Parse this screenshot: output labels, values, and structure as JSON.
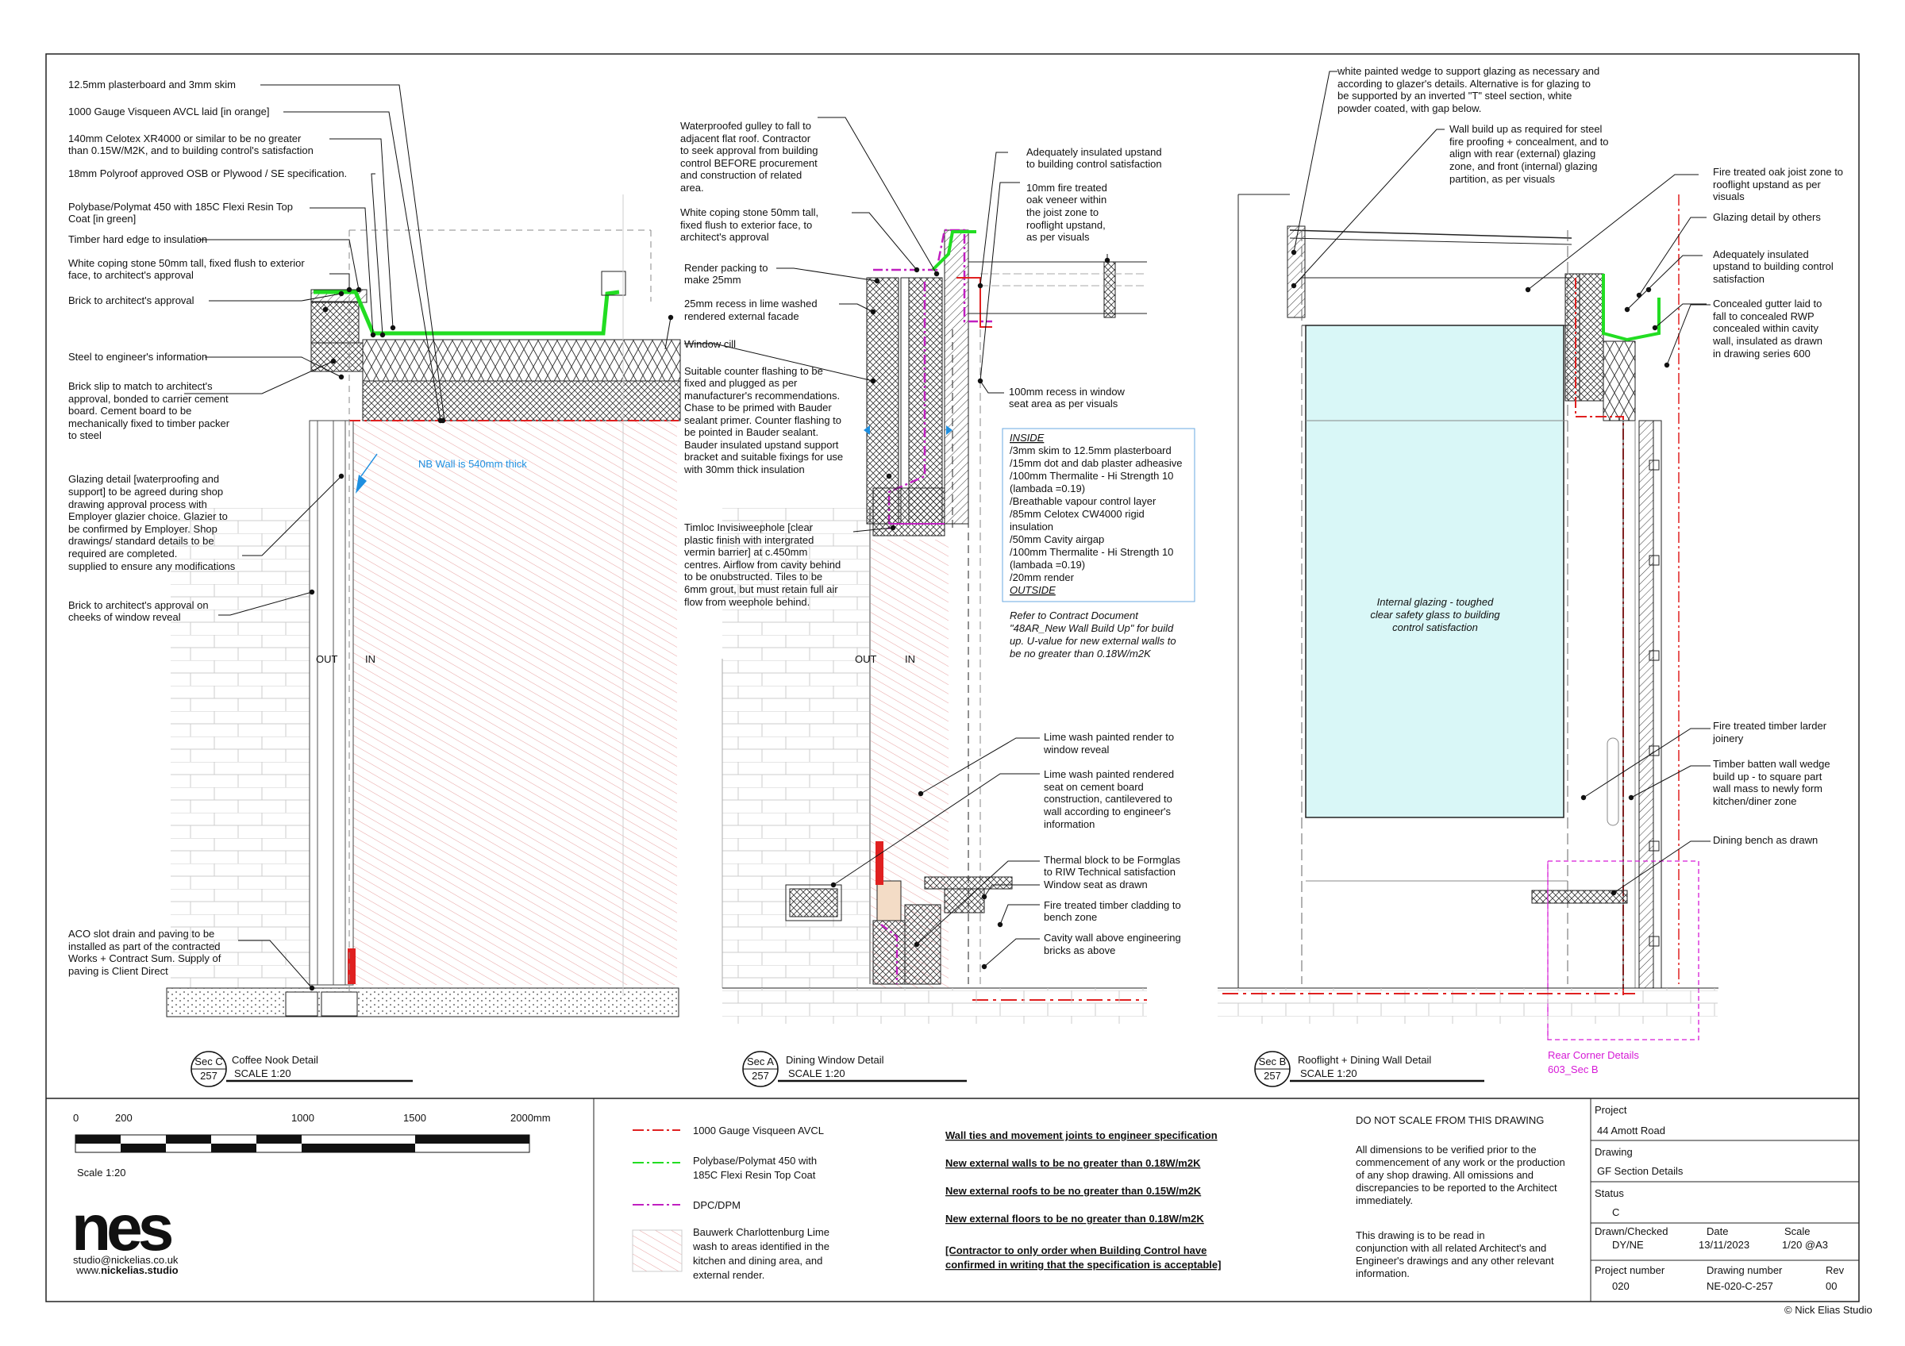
{
  "colors": {
    "avcl": "#e02020",
    "polybase": "#22dd22",
    "dpc": "#c020c0",
    "limewash": "#e7a0a0",
    "glazing": "#d9f7f7",
    "blue_note": "#1e8fe0",
    "magenta_note": "#d61ad6"
  },
  "detail1": {
    "labels": [
      "12.5mm plasterboard and 3mm skim",
      "1000 Gauge Visqueen AVCL laid [in orange]",
      "140mm Celotex XR4000 or similar to be no greater",
      "than 0.15W/M2K, and to building control's satisfaction",
      "18mm Polyroof  approved OSB or Plywood / SE specification.",
      "Polybase/Polymat 450 with 185C Flexi Resin Top",
      "Coat [in green]",
      "Timber hard edge to insulation",
      "White coping stone 50mm tall, fixed flush to exterior",
      "face, to architect's approval",
      "Brick to architect's approval",
      "Steel to engineer's information",
      "Brick slip to match to architect's",
      "approval, bonded to carrier cement",
      "board. Cement board to be",
      "mechanically fixed to timber packer",
      "to steel",
      "Glazing detail [waterproofing and",
      "support] to be agreed during shop",
      "drawing approval process with",
      "Employer glazier choice. Glazier to",
      "be confirmed by Employer. Shop",
      "drawings/ standard details to be",
      "supplied to ensure any modifications",
      "required are completed.",
      "Brick to architect's approval on",
      "cheeks of window reveal",
      "ACO slot drain and paving to be",
      "installed as part of the contracted",
      "Works + Contract Sum. Supply of",
      "paving is Client Direct"
    ],
    "wall_note": "NB Wall is 540mm thick",
    "out": "OUT",
    "in": "IN",
    "title": "Coffee Nook Detail",
    "scale": "SCALE 1:20",
    "ref_top": "Sec C",
    "ref_bottom": "257"
  },
  "detail2": {
    "labels": [
      "Waterproofed gulley to fall to",
      "adjacent flat roof. Contractor",
      "to seek approval from building",
      "control BEFORE procurement",
      "and construction of related",
      "area.",
      "White coping stone 50mm tall,",
      "fixed flush to exterior face, to",
      "architect's approval",
      "Render packing to",
      "make 25mm",
      "25mm recess in lime washed",
      "rendered external facade",
      "Window cill",
      "Suitable counter flashing to be",
      "fixed and plugged as per",
      "manufacturer's recommendations.",
      "Chase to be primed with Bauder",
      "sealant primer. Counter flashing to",
      "be pointed in Bauder sealant.",
      "Bauder insulated upstand support",
      "bracket and suitable fixings for use",
      "with 30mm thick insulation",
      "Timloc Invisiweephole [clear",
      "plastic finish with intergrated",
      "vermin barrier] at c.450mm",
      "centres. Airflow from cavity behind",
      "to be onubstructed. Tiles to be",
      "6mm grout, but must retain full air",
      "flow from weephole behind.",
      "Adequately insulated upstand",
      "to building control satisfaction",
      "10mm fire treated",
      "oak veneer within",
      "the joist zone to",
      "rooflight upstand,",
      "as per visuals",
      "100mm recess in window",
      "seat area as per visuals",
      "Lime wash painted render to",
      "window reveal",
      "Lime wash painted rendered",
      "seat on cement board",
      "construction, cantilevered to",
      "wall according to engineer's",
      "information",
      "Thermal block to be Formglas",
      "to RIW Technical satisfaction",
      "Window seat as drawn",
      "Fire treated timber cladding to",
      "bench zone",
      "Cavity wall above engineering",
      "bricks as above"
    ],
    "buildup": [
      "INSIDE",
      "/3mm skim to 12.5mm plasterboard",
      "/15mm dot and dab plaster adheasive",
      "/100mm Thermalite - Hi Strength 10",
      "(lambada =0.19)",
      "/Breathable vapour control layer",
      "/85mm Celotex CW4000 rigid",
      "insulation",
      "/50mm Cavity airgap",
      "/100mm Thermalite - Hi Strength 10",
      "(lambada =0.19)",
      "/20mm render",
      "OUTSIDE"
    ],
    "contract_note": [
      "Refer to Contract Document",
      "\"48AR_New Wall Build Up\" for build",
      "up. U-value for new external walls to",
      "be no greater than 0.18W/m2K"
    ],
    "out": "OUT",
    "in": "IN",
    "title": "Dining Window Detail",
    "scale": "SCALE 1:20",
    "ref_top": "Sec A",
    "ref_bottom": "257"
  },
  "detail3": {
    "labels": [
      "white painted wedge to support glazing as necessary and",
      "according to glazer's details. Alternative is for glazing to",
      "be supported by an inverted  \"T\" steel section, white",
      "powder coated, with gap below.",
      "Wall build up as required for steel",
      "fire proofing + concealment, and to",
      "align with rear (external) glazing",
      "zone, and front (internal) glazing",
      "partition, as per visuals",
      "Fire treated oak joist zone to",
      "rooflight upstand as per",
      "visuals",
      "Glazing detail by others",
      "Adequately insulated",
      "upstand to building control",
      "satisfaction",
      "Concealed gutter laid to",
      "fall to concealed RWP",
      "concealed within cavity",
      "wall, insulated as drawn",
      "in drawing series 600",
      "Fire treated timber larder",
      "joinery",
      "Timber batten wall wedge",
      "build up - to square part",
      "wall mass to newly form",
      "kitchen/diner zone",
      "Dining bench as drawn"
    ],
    "glazing_note": [
      "Internal glazing - toughed",
      "clear safety glass to building",
      "control satisfaction"
    ],
    "rear_note": [
      "Rear Corner Details",
      "603_Sec B"
    ],
    "title": "Rooflight + Dining Wall Detail",
    "scale": "SCALE 1:20",
    "ref_top": "Sec B",
    "ref_bottom": "257"
  },
  "scale_bar": {
    "ticks": [
      "0",
      "200",
      "1000",
      "1500",
      "2000mm"
    ],
    "label": "Scale 1:20"
  },
  "logo": {
    "text": "nes",
    "email": "studio@nickelias.co.uk",
    "web_prefix": "www.",
    "web_bold": "nickelias.studio"
  },
  "legend": [
    {
      "label": [
        "1000 Gauge Visqueen AVCL"
      ]
    },
    {
      "label": [
        "Polybase/Polymat 450 with",
        "185C Flexi Resin Top Coat"
      ]
    },
    {
      "label": [
        "DPC/DPM"
      ]
    },
    {
      "label": [
        "Bauwerk Charlottenburg Lime",
        "wash to areas identified in the",
        "kitchen and dining area, and",
        "external render."
      ]
    }
  ],
  "specs": [
    "Wall ties and movement joints to engineer specification",
    "New external walls to be no greater than 0.18W/m2K",
    "New external roofs to be no greater than 0.15W/m2K",
    "New external floors to be no greater than 0.18W/m2K",
    "[Contractor to only order when Building Control have",
    "confirmed in writing that the specification is acceptable]"
  ],
  "disclaimer": {
    "title": "DO NOT SCALE FROM THIS DRAWING",
    "para1": [
      "All dimensions to be verified prior to the",
      "commencement of any work or the production",
      "of any shop drawing. All omissions and",
      "discrepancies to be reported to the Architect",
      "immediately."
    ],
    "para2": [
      "This drawing is to be read in",
      "conjunction with all related Architect's and",
      "Engineer's drawings and any other relevant",
      "information."
    ]
  },
  "title_block": {
    "project_label": "Project",
    "project": "44 Amott Road",
    "drawing_label": "Drawing",
    "drawing": "GF Section Details",
    "status_label": "Status",
    "status": "C",
    "drawn_label": "Drawn/Checked",
    "drawn": "DY/NE",
    "date_label": "Date",
    "date": "13/11/2023",
    "scale_label": "Scale",
    "scale": "1/20 @A3",
    "projnum_label": "Project number",
    "projnum": "020",
    "drawnum_label": "Drawing number",
    "drawnum": "NE-020-C-257",
    "rev_label": "Rev",
    "rev": "00"
  },
  "copyright": "© Nick Elias Studio"
}
